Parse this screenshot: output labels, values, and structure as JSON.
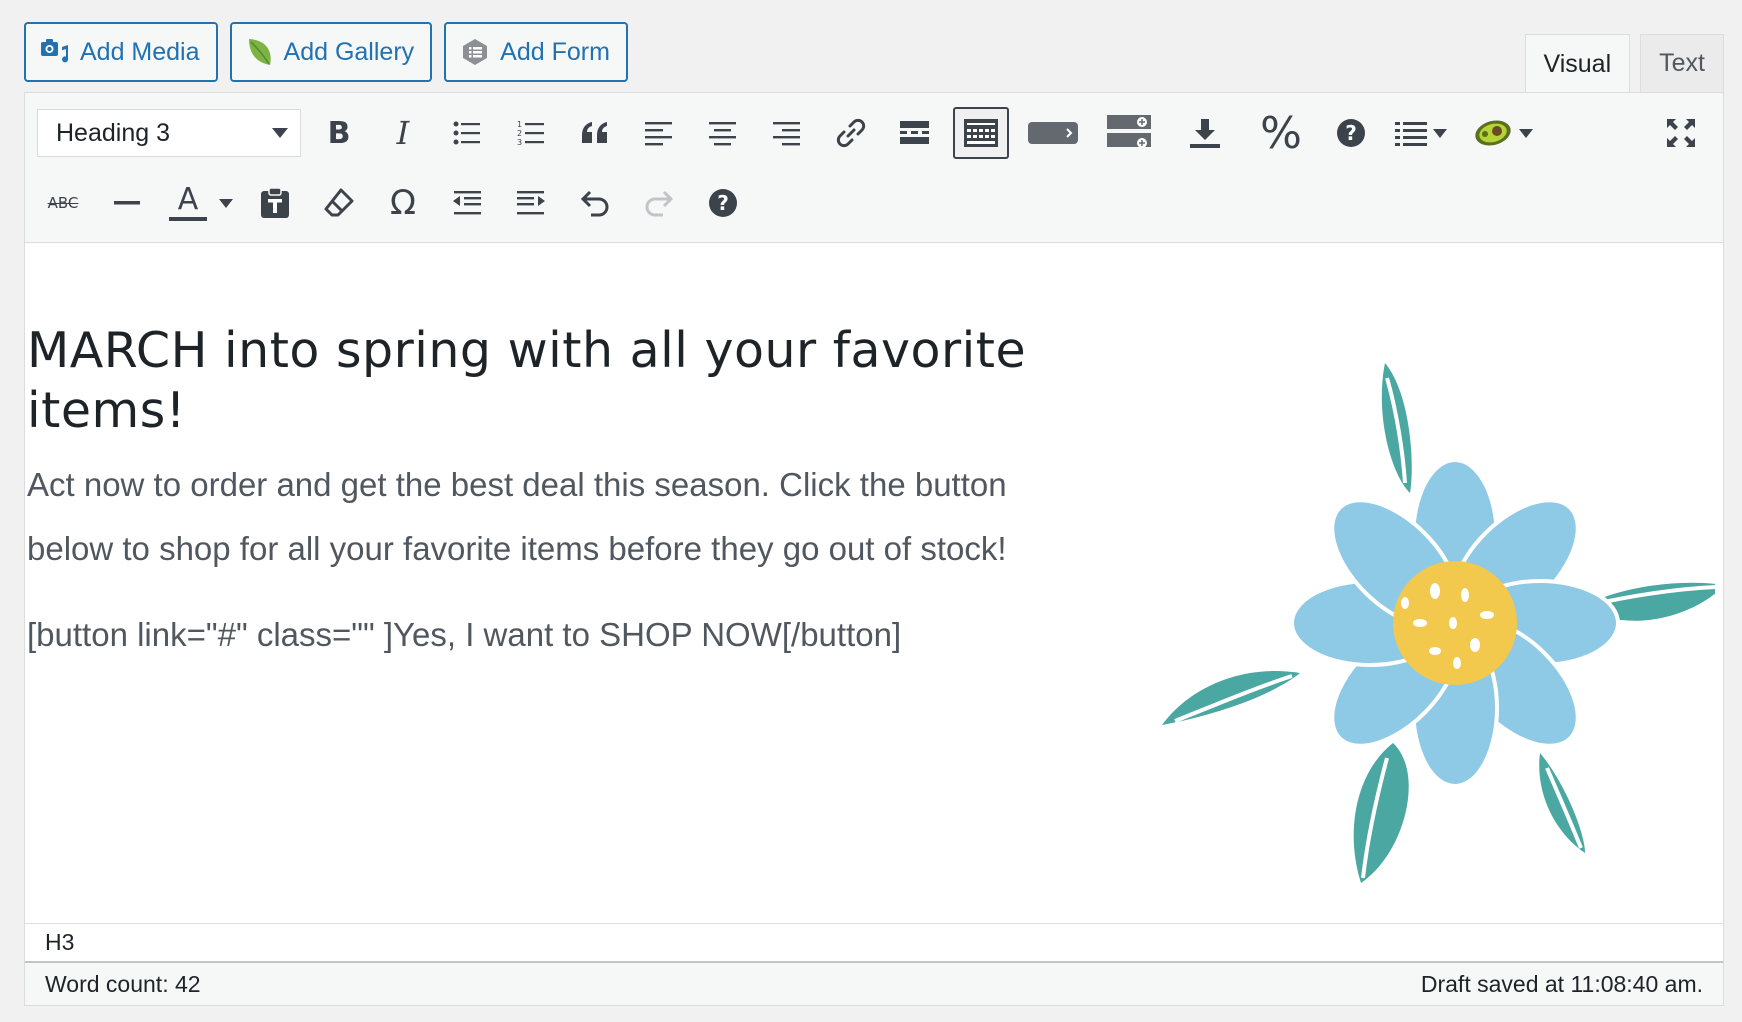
{
  "media_buttons": {
    "add_media": "Add Media",
    "add_gallery": "Add Gallery",
    "add_form": "Add Form"
  },
  "tabs": {
    "visual": "Visual",
    "text": "Text",
    "active": "visual"
  },
  "toolbar": {
    "format_select_value": "Heading 3",
    "row1_icons": [
      "bold-icon",
      "italic-icon",
      "bulleted-list-icon",
      "numbered-list-icon",
      "blockquote-icon",
      "align-left-icon",
      "align-center-icon",
      "align-right-icon",
      "link-icon",
      "read-more-icon",
      "toolbar-toggle-icon",
      "button-shortcode-icon",
      "table-shortcode-icon",
      "download-icon",
      "percent-icon",
      "help-icon",
      "columns-icon",
      "avocado-plugin-icon",
      "fullscreen-icon"
    ],
    "row2_icons": [
      "strikethrough-icon",
      "horizontal-line-icon",
      "text-color-icon",
      "paste-as-text-icon",
      "clear-formatting-icon",
      "special-character-icon",
      "outdent-icon",
      "indent-icon",
      "undo-icon",
      "redo-icon",
      "keyboard-shortcuts-icon"
    ],
    "strikethrough_label": "ABC",
    "text_color_label": "A",
    "bold_label": "B",
    "italic_label": "I",
    "omega_label": "Ω",
    "percent_label": "%",
    "help_label": "?"
  },
  "content": {
    "heading": "MARCH into spring with all your favorite items!",
    "paragraph": "Act now to order and get the best deal this season. Click the button below to shop for all your favorite items before they go out of stock!",
    "shortcode": "[button link=\"#\" class=\"\" ]Yes, I want to SHOP NOW[/button]"
  },
  "status": {
    "path": "H3",
    "word_count": "Word count: 42",
    "draft_saved": "Draft saved at 11:08:40 am."
  },
  "colors": {
    "accent": "#2271b1",
    "petal": "#8ecae6",
    "leaf": "#4aa7a1",
    "center": "#f2c94c"
  }
}
